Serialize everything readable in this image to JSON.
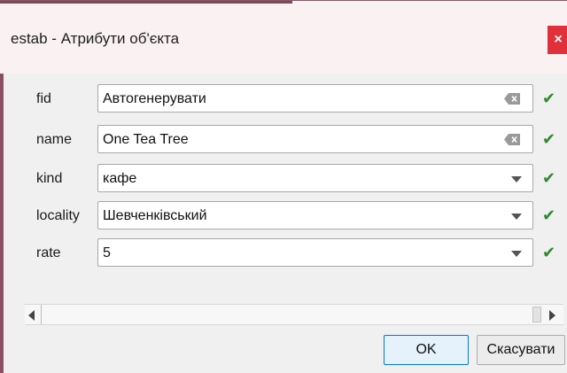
{
  "window": {
    "title": "estab - Атрибути об'єкта",
    "close_label": "×"
  },
  "fields": [
    {
      "label": "fid",
      "value": "Автогенерувати",
      "control": "text-with-clear"
    },
    {
      "label": "name",
      "value": "One Tea Tree",
      "control": "text-with-clear"
    },
    {
      "label": "kind",
      "value": "кафе",
      "control": "dropdown"
    },
    {
      "label": "locality",
      "value": "Шевченківський",
      "control": "dropdown"
    },
    {
      "label": "rate",
      "value": "5",
      "control": "dropdown"
    }
  ],
  "status_icon": "checkmark-icon",
  "check_glyph": "✔",
  "buttons": {
    "ok_label": "OK",
    "cancel_label": "Скасувати"
  },
  "colors": {
    "check": "#2e8b2e",
    "close": "#e0303a",
    "ok_border": "#0078d7"
  }
}
